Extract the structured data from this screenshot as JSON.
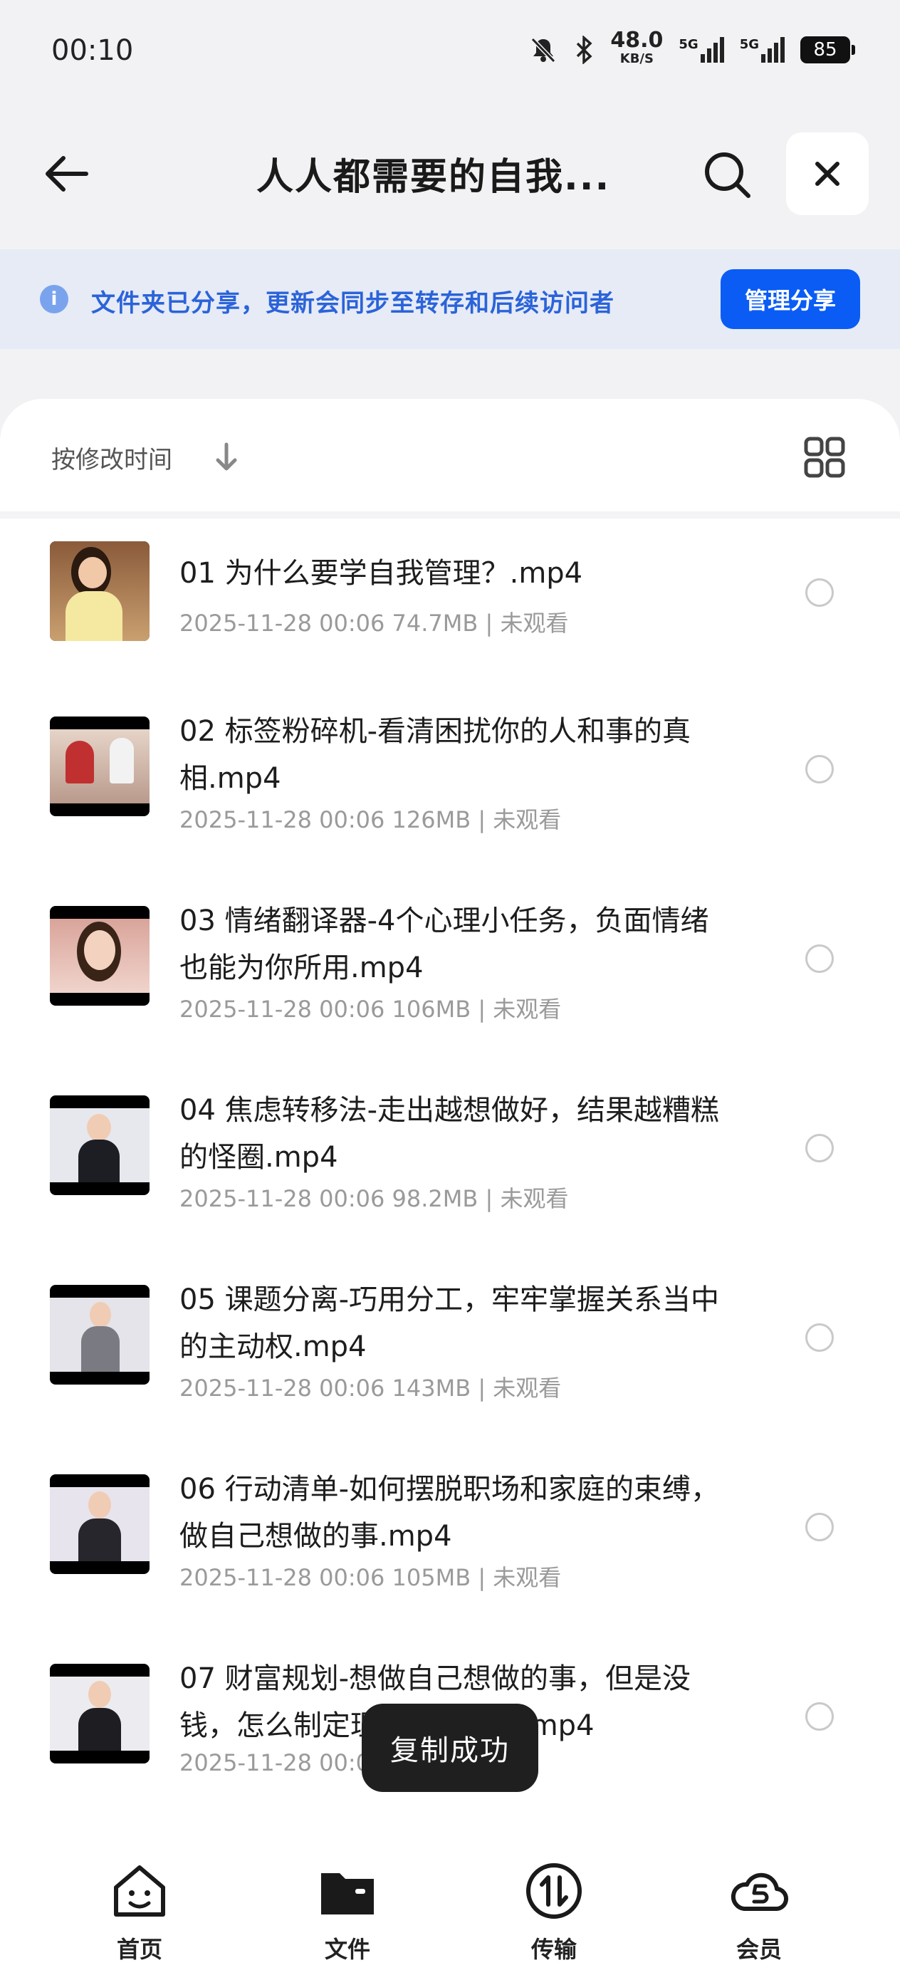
{
  "status_bar": {
    "time": "00:10",
    "net_speed": "48.0",
    "net_speed_unit": "KB/S",
    "signal_1": "5G",
    "signal_2": "5G",
    "battery": "85",
    "icons": [
      "mute-bell-icon",
      "bluetooth-icon",
      "signal-icon",
      "signal-icon",
      "battery-icon"
    ]
  },
  "header": {
    "title": "人人都需要的自我...",
    "back_icon": "arrow-left-icon",
    "search_icon": "search-icon",
    "close_icon": "close-icon"
  },
  "banner": {
    "text": "文件夹已分享，更新会同步至转存和后续访问者",
    "button": "管理分享",
    "accent": "#0a5cf5"
  },
  "toolbar": {
    "sort_label": "按修改时间",
    "sort_icon": "arrow-down-icon",
    "view_icon": "grid-view-icon"
  },
  "files": [
    {
      "name": "01 为什么要学自我管理？.mp4",
      "date": "2025-11-28 00:06",
      "size": "74.7MB",
      "status": "未观看"
    },
    {
      "name": "02 标签粉碎机-看清困扰你的人和事的真相.mp4",
      "date": "2025-11-28 00:06",
      "size": "126MB",
      "status": "未观看"
    },
    {
      "name": "03 情绪翻译器-4个心理小任务，负面情绪也能为你所用.mp4",
      "date": "2025-11-28 00:06",
      "size": "106MB",
      "status": "未观看"
    },
    {
      "name": "04 焦虑转移法-走出越想做好，结果越糟糕的怪圈.mp4",
      "date": "2025-11-28 00:06",
      "size": "98.2MB",
      "status": "未观看"
    },
    {
      "name": "05 课题分离-巧用分工，牢牢掌握关系当中的主动权.mp4",
      "date": "2025-11-28 00:06",
      "size": "143MB",
      "status": "未观看"
    },
    {
      "name": "06 行动清单-如何摆脱职场和家庭的束缚，做自己想做的事.mp4",
      "date": "2025-11-28 00:06",
      "size": "105MB",
      "status": "未观看"
    },
    {
      "name": "07 财富规划-想做自己想做的事，但是没钱，怎么制定理财计划【】.mp4",
      "date": "2025-11-28 00:06",
      "size": "",
      "status": ""
    }
  ],
  "toast": {
    "text": "复制成功"
  },
  "nav": [
    {
      "label": "首页",
      "icon": "home-face-icon"
    },
    {
      "label": "文件",
      "icon": "folder-icon"
    },
    {
      "label": "传输",
      "icon": "transfer-icon"
    },
    {
      "label": "会员",
      "icon": "vip-cloud-icon"
    }
  ]
}
